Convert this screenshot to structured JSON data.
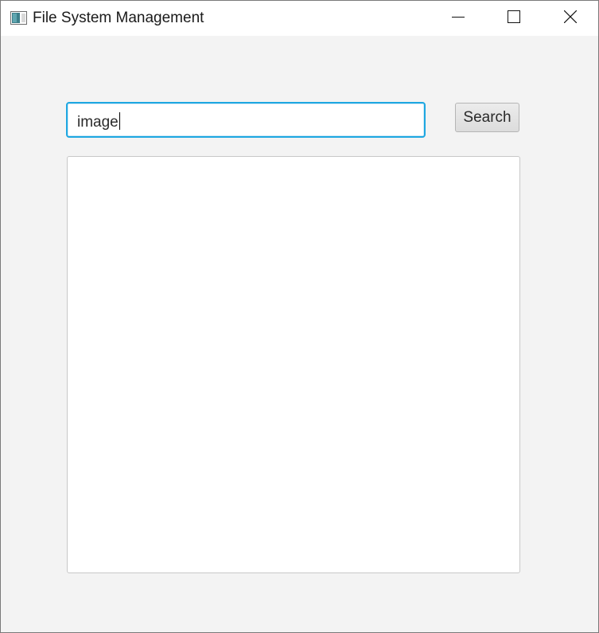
{
  "window": {
    "title": "File System Management",
    "app_icon": "java-app-icon",
    "controls": {
      "minimize_icon": "minimize-icon",
      "maximize_icon": "maximize-icon",
      "close_icon": "close-icon"
    }
  },
  "search": {
    "value": "image",
    "button_label": "Search"
  },
  "results": {
    "items": []
  },
  "colors": {
    "focus_border": "#1ea7e1",
    "window_background": "#f3f3f3",
    "titlebar_background": "#ffffff"
  }
}
